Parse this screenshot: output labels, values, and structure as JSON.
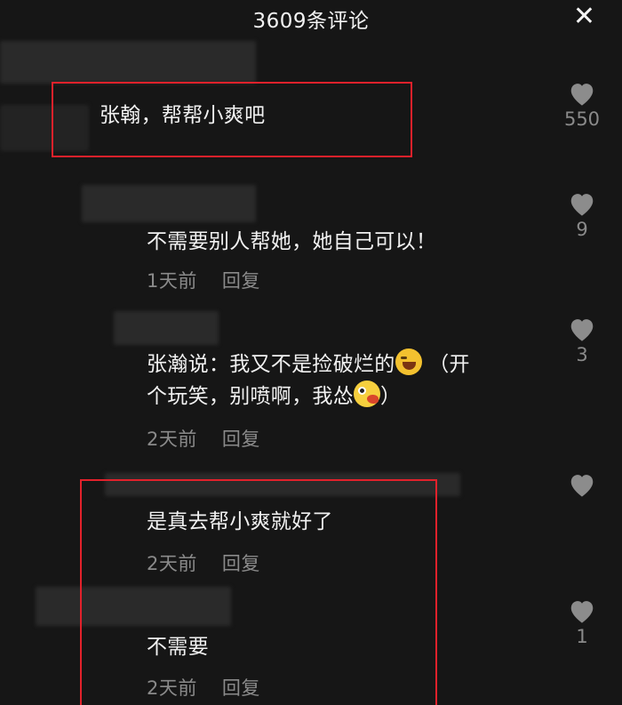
{
  "header": {
    "title": "3609条评论",
    "close_glyph": "✕"
  },
  "comments": [
    {
      "text": "张翰，帮帮小爽吧",
      "likes": "550"
    },
    {
      "text": "不需要别人帮她，她自己可以！",
      "time": "1天前",
      "reply": "回复",
      "likes": "9"
    },
    {
      "text_a": "张瀚说：我又不是捡破烂的",
      "text_b": "（开",
      "text_c": "个玩笑，别喷啊，我怂",
      "text_d": "）",
      "time": "2天前",
      "reply": "回复",
      "likes": "3"
    },
    {
      "text": "是真去帮小爽就好了",
      "time": "2天前",
      "reply": "回复"
    },
    {
      "text": "不需要",
      "time": "2天前",
      "reply": "回复",
      "likes": "1"
    }
  ],
  "icons": {
    "heart": "heart-icon",
    "laugh": "tears-of-joy-emoji-icon",
    "gross": "nauseated-emoji-icon",
    "close": "close-icon"
  },
  "colors": {
    "background": "#161616",
    "highlight_box": "#e2212b",
    "muted": "#8a8a8a"
  }
}
